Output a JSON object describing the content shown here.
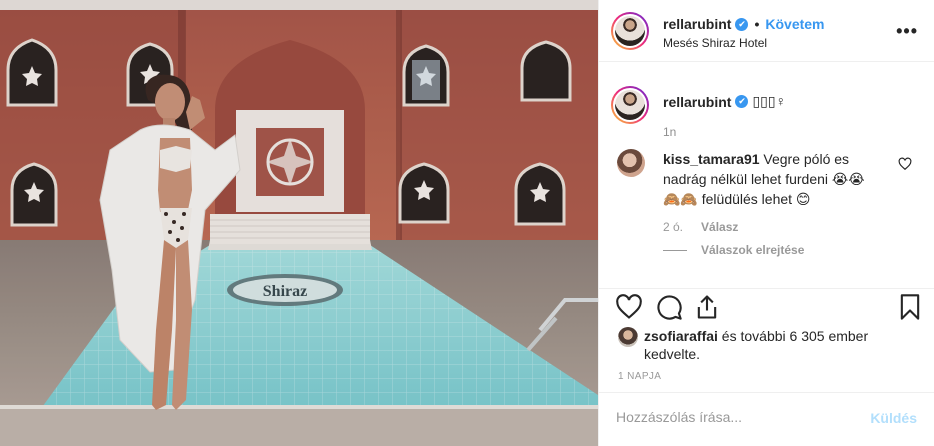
{
  "post": {
    "author": "rellarubint",
    "verified_mark": "✔",
    "follow_separator": "•",
    "follow_label": "Követem",
    "location": "Mesés Shiraz Hotel",
    "more_label": "•••",
    "photo_alt": "Woman in white bathrobe and bikini standing by a pool in a terracotta courtyard",
    "pool_sign_text": "Shiraz"
  },
  "caption": {
    "user": "rellarubint",
    "text": "▯▯▯♀",
    "time": "1n"
  },
  "comment": {
    "user": "kiss_tamara91",
    "text": "Vegre póló es nadrág nélkül lehet furdeni 😭😭 🙈🙈 felüdülés lehet 😊",
    "time": "2 ó.",
    "reply_label": "Válasz",
    "hide_replies_label": "Válaszok elrejtése"
  },
  "likes": {
    "first_user": "zsofiaraffai",
    "rest": " és további 6 305 ember kedvelte."
  },
  "date_label": "1 NAPJA",
  "composer": {
    "placeholder": "Hozzászólás írása...",
    "send_label": "Küldés"
  },
  "icons": {
    "like": "heart-icon",
    "comment": "comment-icon",
    "share": "share-icon",
    "save": "bookmark-icon",
    "comment_like": "heart-icon",
    "more": "more-icon"
  },
  "colors": {
    "accent": "#3897f0",
    "send_disabled": "#b2dffc",
    "muted": "#8e8e8e",
    "border": "#efefef",
    "wall": "#b5614f",
    "pool": "#8fd3d6"
  }
}
